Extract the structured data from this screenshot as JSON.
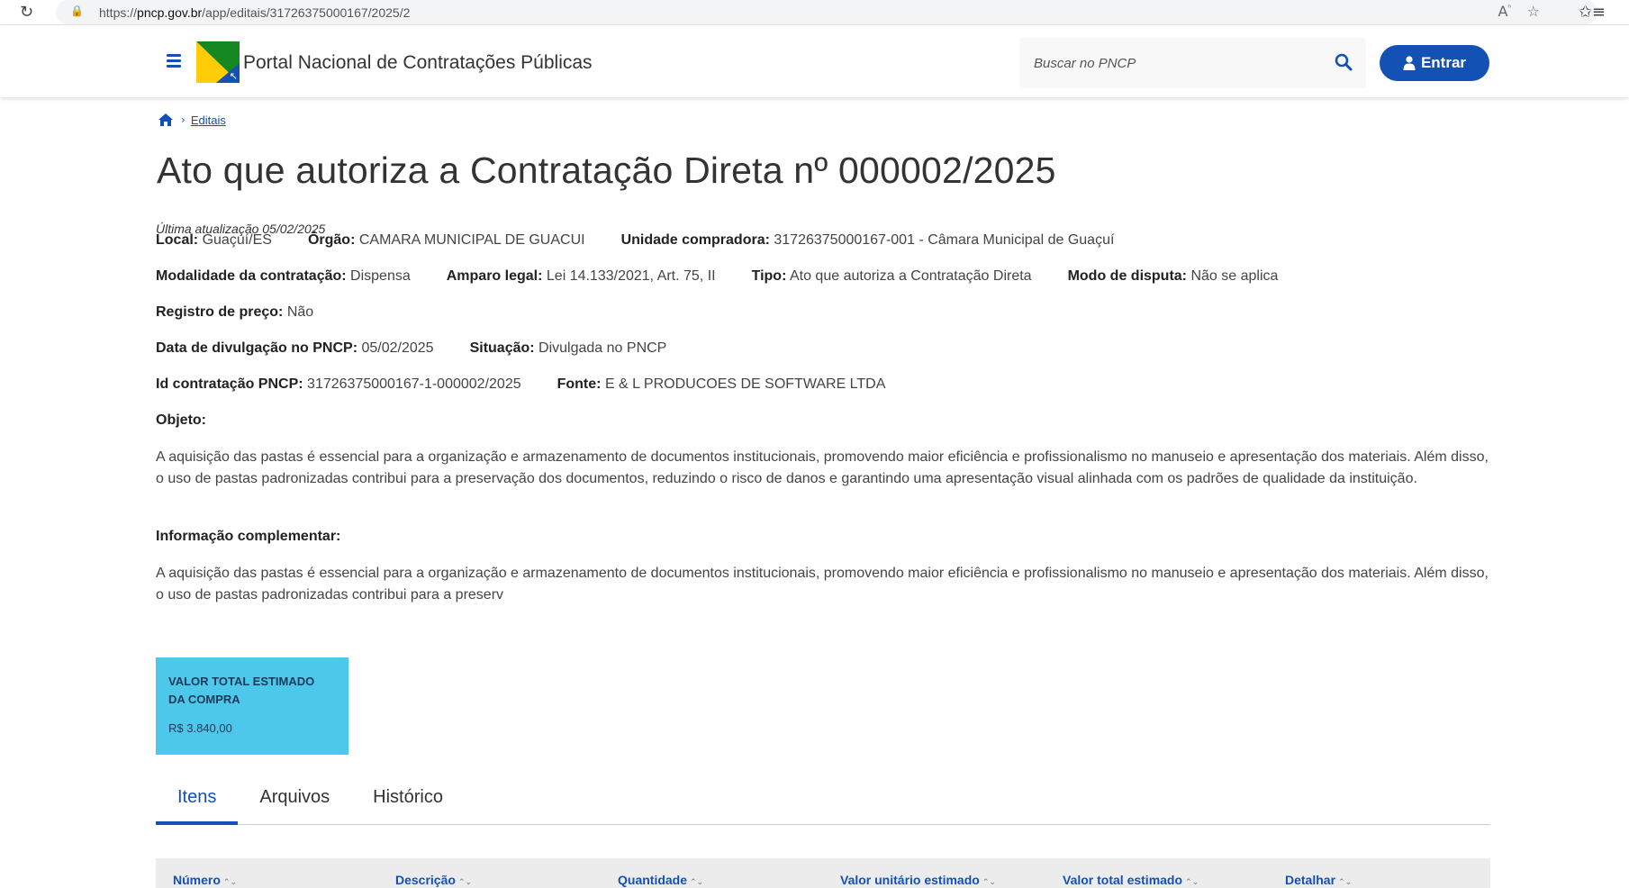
{
  "browser": {
    "url_prefix": "https://",
    "url_host": "pncp.gov.br",
    "url_path": "/app/editais/31726375000167/2025/2"
  },
  "header": {
    "site_title": "Portal Nacional de Contratações Públicas",
    "search_placeholder": "Buscar no PNCP",
    "login_label": "Entrar"
  },
  "breadcrumb": {
    "link": "Editais"
  },
  "page": {
    "title": "Ato que autoriza a Contratação Direta nº 000002/2025",
    "last_update": "Última atualização 05/02/2025"
  },
  "info": {
    "local_label": "Local:",
    "local_value": "Guaçuí/ES",
    "orgao_label": "Órgão:",
    "orgao_value": "CAMARA MUNICIPAL DE GUACUI",
    "unidade_label": "Unidade compradora:",
    "unidade_value": "31726375000167-001 - Câmara Municipal de Guaçuí",
    "modalidade_label": "Modalidade da contratação:",
    "modalidade_value": "Dispensa",
    "amparo_label": "Amparo legal:",
    "amparo_value": "Lei 14.133/2021, Art. 75, II",
    "tipo_label": "Tipo:",
    "tipo_value": "Ato que autoriza a Contratação Direta",
    "modo_label": "Modo de disputa:",
    "modo_value": "Não se aplica",
    "registro_label": "Registro de preço:",
    "registro_value": "Não",
    "data_label": "Data de divulgação no PNCP:",
    "data_value": "05/02/2025",
    "situacao_label": "Situação:",
    "situacao_value": "Divulgada no PNCP",
    "id_label": "Id contratação PNCP:",
    "id_value": "31726375000167-1-000002/2025",
    "fonte_label": "Fonte:",
    "fonte_value": "E & L PRODUCOES DE SOFTWARE LTDA"
  },
  "objeto": {
    "label": "Objeto:",
    "text": "A aquisição das pastas é essencial para a organização e armazenamento de documentos institucionais, promovendo maior eficiência e profissionalismo no manuseio e apresentação dos materiais. Além disso, o uso de pastas padronizadas contribui para a preservação dos documentos, reduzindo o risco de danos e garantindo uma apresentação visual alinhada com os padrões de qualidade da instituição."
  },
  "complementar": {
    "label": "Informação complementar:",
    "text": "A aquisição das pastas é essencial para a organização e armazenamento de documentos institucionais, promovendo maior eficiência e profissionalismo no manuseio e apresentação dos materiais. Além disso, o uso de pastas padronizadas contribui para a preserv"
  },
  "valor": {
    "title": "VALOR TOTAL ESTIMADO DA COMPRA",
    "amount": "R$ 3.840,00"
  },
  "tabs": [
    "Itens",
    "Arquivos",
    "Histórico"
  ],
  "table": {
    "columns": [
      "Número",
      "Descrição",
      "Quantidade",
      "Valor unitário estimado",
      "Valor total estimado",
      "Detalhar"
    ]
  },
  "colors": {
    "primary": "#1351b4",
    "card": "#4dc8ea"
  }
}
